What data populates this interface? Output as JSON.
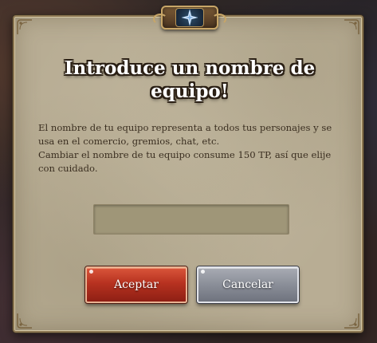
{
  "dialog": {
    "title": "Introduce un nombre de equipo!",
    "description_lines": [
      "El nombre de tu equipo representa a todos tus personajes y se usa en el comercio, gremios, chat, etc.",
      "Cambiar el nombre de tu equipo consume 150 TP, así que elije con cuidado."
    ],
    "team_name_input": {
      "value": "",
      "placeholder": ""
    },
    "buttons": {
      "accept_label": "Aceptar",
      "cancel_label": "Cancelar"
    },
    "crest_icon": "compass-star-icon"
  },
  "colors": {
    "accept": "#b73220",
    "cancel": "#8a8e98",
    "panel": "#b8ad94",
    "border": "#8a7550"
  }
}
